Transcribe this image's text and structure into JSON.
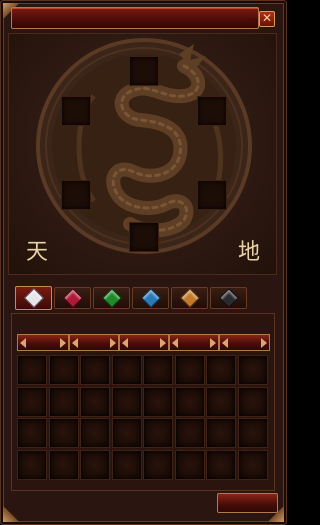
{
  "window": {
    "title": "",
    "close_glyph": "✕"
  },
  "altar": {
    "left_char": "天",
    "right_char": "地",
    "emblem_icon": "dragon-emblem-icon",
    "slots": [
      {
        "id": "top",
        "item": ""
      },
      {
        "id": "upper-left",
        "item": ""
      },
      {
        "id": "upper-right",
        "item": ""
      },
      {
        "id": "lower-left",
        "item": ""
      },
      {
        "id": "lower-right",
        "item": ""
      },
      {
        "id": "bottom",
        "item": ""
      }
    ]
  },
  "gem_tabs": [
    {
      "name": "white",
      "color": "#e6e6ea",
      "active": true
    },
    {
      "name": "red",
      "color": "#b01a3a",
      "active": false
    },
    {
      "name": "green",
      "color": "#1f8a2a",
      "active": false
    },
    {
      "name": "blue",
      "color": "#2a7ab8",
      "active": false
    },
    {
      "name": "orange",
      "color": "#c47a2a",
      "active": false
    },
    {
      "name": "black",
      "color": "#2a2a30",
      "active": false
    }
  ],
  "category_headers": [
    "",
    "",
    "",
    "",
    ""
  ],
  "inventory": {
    "columns": 8,
    "rows": 4
  },
  "action_button": {
    "label": ""
  },
  "colors": {
    "frame": "#2b1510",
    "accent_red": "#7a1b12",
    "trim_gold": "#b07a4a",
    "text": "#e8d2a8"
  }
}
